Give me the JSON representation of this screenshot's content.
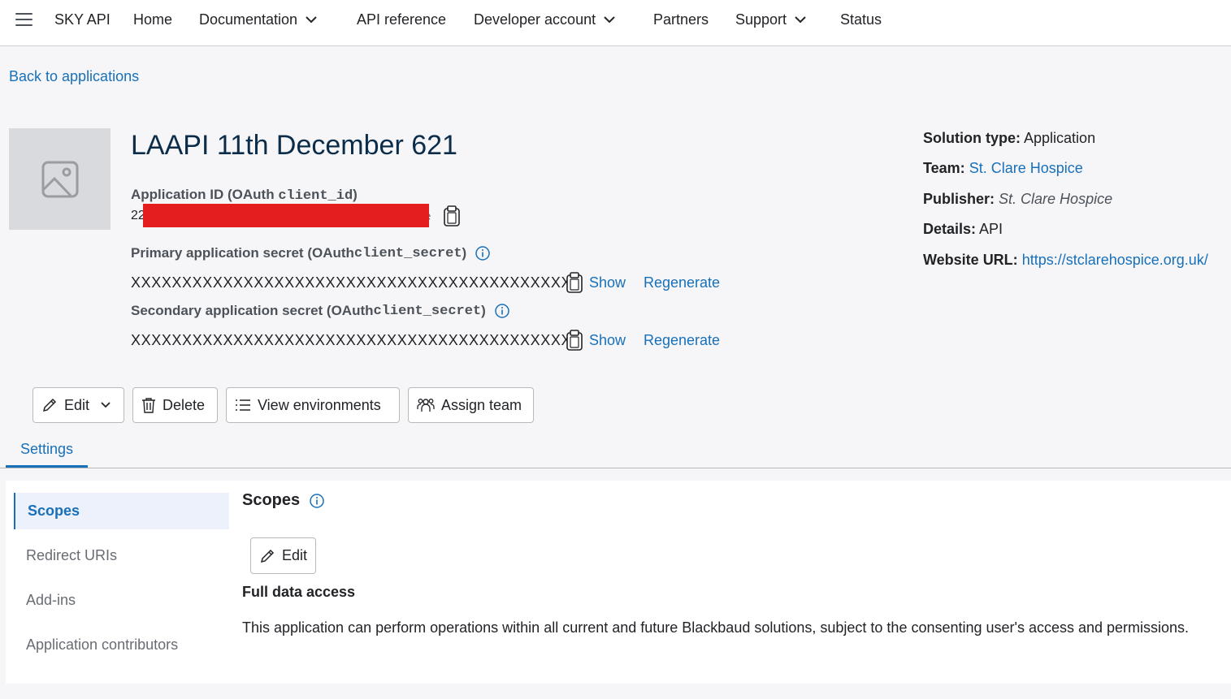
{
  "nav": {
    "brand": "SKY API",
    "items": [
      {
        "label": "Home"
      },
      {
        "label": "Documentation"
      },
      {
        "label": "API reference"
      },
      {
        "label": "Developer account"
      },
      {
        "label": "Partners"
      },
      {
        "label": "Support"
      },
      {
        "label": "Status"
      }
    ]
  },
  "back_link": "Back to applications",
  "app": {
    "title": "LAAPI 11th December 621",
    "id_label_prefix": "Application ID (OAuth ",
    "id_label_code": "client_id",
    "id_label_suffix": ")",
    "id_value_visible": "22",
    "id_suffix_visible": "e",
    "primary": {
      "label_prefix": "Primary application secret (OAuth ",
      "label_code": "client_secret",
      "label_suffix": ")",
      "value": "XXXXXXXXXXXXXXXXXXXXXXXXXXXXXXXXXXXXXXXXXXXX",
      "show": "Show",
      "regenerate": "Regenerate"
    },
    "secondary": {
      "label_prefix": "Secondary application secret (OAuth ",
      "label_code": "client_secret",
      "label_suffix": ")",
      "value": "XXXXXXXXXXXXXXXXXXXXXXXXXXXXXXXXXXXXXXXXXXXX",
      "show": "Show",
      "regenerate": "Regenerate"
    }
  },
  "details": {
    "solution_type_label": "Solution type:",
    "solution_type": "Application",
    "team_label": "Team:",
    "team": "St. Clare Hospice",
    "publisher_label": "Publisher:",
    "publisher": "St. Clare Hospice",
    "details_label": "Details:",
    "details": "API",
    "website_label": "Website URL:",
    "website": "https://stclarehospice.org.uk/"
  },
  "actions": {
    "edit": "Edit",
    "delete": "Delete",
    "view_environments": "View environments",
    "assign_team": "Assign team"
  },
  "tabs": {
    "settings": "Settings"
  },
  "side_nav": {
    "items": [
      {
        "label": "Scopes"
      },
      {
        "label": "Redirect URIs"
      },
      {
        "label": "Add-ins"
      },
      {
        "label": "Application contributors"
      }
    ]
  },
  "scopes": {
    "title": "Scopes",
    "edit": "Edit",
    "access_title": "Full data access",
    "description": "This application can perform operations within all current and future Blackbaud solutions, subject to the consenting user's access and permissions."
  },
  "colors": {
    "link": "#1870b8",
    "title": "#0b2d4a",
    "redaction": "#e41e1e",
    "active_bg": "#edf1fb"
  }
}
